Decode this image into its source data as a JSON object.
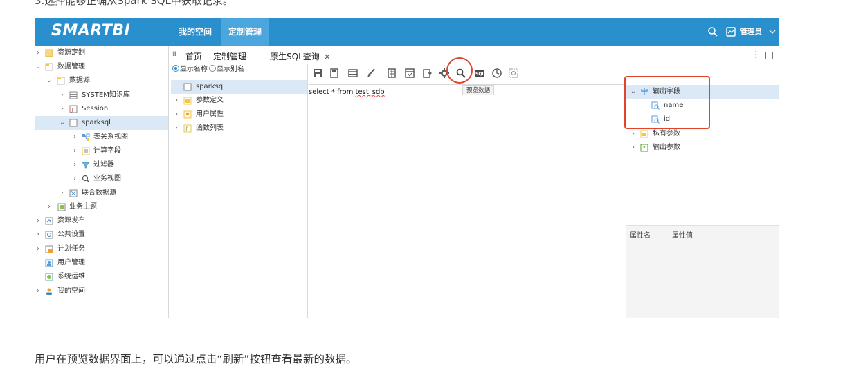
{
  "doc": {
    "top_text": "3.选择能够正确从Spark SQL中获取记录。",
    "bottom_text": "用户在预览数据界面上，可以通过点击“刷新”按钮查看最新的数据。"
  },
  "header": {
    "logo": "SMARTBI",
    "nav": [
      "我的空间",
      "定制管理"
    ],
    "user": "管理员"
  },
  "tree": [
    {
      "label": "资源定制",
      "arrow": "›"
    },
    {
      "label": "数据管理",
      "arrow": "⌄"
    },
    {
      "label": "数据源",
      "arrow": "⌄"
    },
    {
      "label": "SYSTEM知识库",
      "arrow": "›"
    },
    {
      "label": "Session",
      "arrow": "›"
    },
    {
      "label": "sparksql",
      "arrow": "⌄"
    },
    {
      "label": "表关系视图",
      "arrow": "›"
    },
    {
      "label": "计算字段",
      "arrow": "›"
    },
    {
      "label": "过滤器",
      "arrow": "›"
    },
    {
      "label": "业务视图",
      "arrow": "›"
    },
    {
      "label": "联合数据源",
      "arrow": "›"
    },
    {
      "label": "业务主题",
      "arrow": "›"
    },
    {
      "label": "资源发布",
      "arrow": "›"
    },
    {
      "label": "公共设置",
      "arrow": "›"
    },
    {
      "label": "计划任务",
      "arrow": "›"
    },
    {
      "label": "用户管理",
      "arrow": ""
    },
    {
      "label": "系统运维",
      "arrow": ""
    },
    {
      "label": "我的空间",
      "arrow": "›"
    }
  ],
  "tabs": {
    "grip": "III",
    "items": [
      "首页",
      "定制管理",
      "原生SQL查询"
    ],
    "close": "×"
  },
  "middle": {
    "radio_name": "显示名称",
    "radio_alias": "显示别名",
    "items": [
      {
        "label": "sparksql",
        "arrow": ""
      },
      {
        "label": "参数定义",
        "arrow": "›"
      },
      {
        "label": "用户属性",
        "arrow": "›"
      },
      {
        "label": "函数列表",
        "arrow": "›"
      }
    ]
  },
  "toolbar": {
    "sql_badge": "SQL"
  },
  "editor": {
    "sql_prefix": "select * from ",
    "sql_table": "test_sdb",
    "tooltip": "预览数据"
  },
  "right": {
    "items": [
      {
        "label": "输出字段",
        "arrow": "⌄"
      },
      {
        "label": "name",
        "arrow": ""
      },
      {
        "label": "id",
        "arrow": ""
      },
      {
        "label": "私有参数",
        "arrow": "›"
      },
      {
        "label": "输出参数",
        "arrow": "›"
      }
    ],
    "prop_name": "属性名",
    "prop_value": "属性值"
  }
}
